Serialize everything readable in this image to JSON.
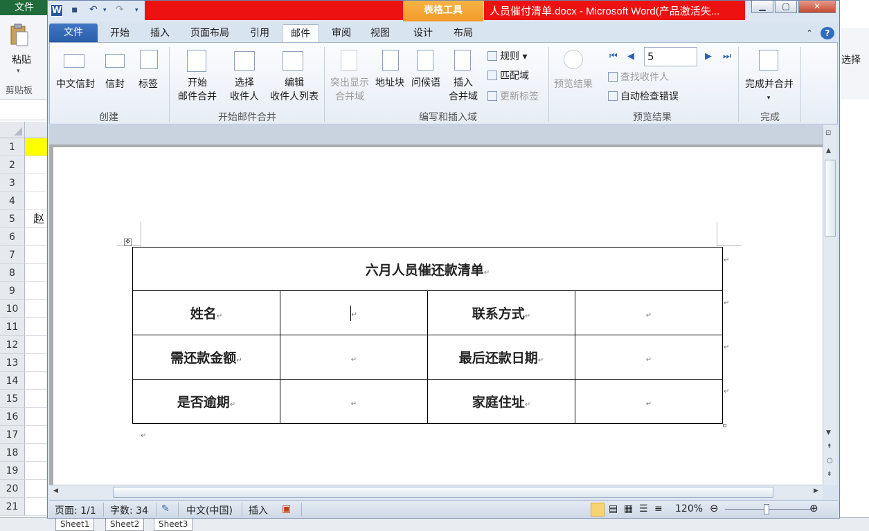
{
  "excel": {
    "file_tab": "文件",
    "paste_label": "粘贴",
    "clipboard_label": "剪贴板",
    "row_numbers": [
      "1",
      "2",
      "3",
      "4",
      "5",
      "6",
      "7",
      "8",
      "9",
      "10",
      "11",
      "12",
      "13",
      "14",
      "15",
      "16",
      "17",
      "18",
      "19",
      "20",
      "21"
    ],
    "col_a_fragments": [
      "",
      "　",
      "",
      "",
      "赵",
      "",
      "",
      "",
      "",
      "",
      "",
      "",
      "",
      "",
      "",
      "",
      "",
      "",
      "",
      "",
      ""
    ],
    "right_select_label": "选择",
    "sheet_tabs": [
      "Sheet1",
      "Sheet2",
      "Sheet3"
    ]
  },
  "word": {
    "app_icon": "W",
    "table_tools": "表格工具",
    "title": "人员催付清单.docx - Microsoft Word(产品激活失...",
    "tabs": [
      "文件",
      "开始",
      "插入",
      "页面布局",
      "引用",
      "邮件",
      "审阅",
      "视图",
      "设计",
      "布局"
    ],
    "active_tab": "邮件",
    "ribbon": {
      "create": {
        "label": "创建",
        "buttons": [
          "中文信封",
          "信封",
          "标签"
        ]
      },
      "start_merge": {
        "label": "开始邮件合并",
        "buttons": [
          [
            "开始",
            "邮件合并"
          ],
          [
            "选择",
            "收件人"
          ],
          [
            "编辑",
            "收件人列表"
          ]
        ]
      },
      "write_insert": {
        "label": "编写和插入域",
        "buttons": [
          [
            "突出显示",
            "合并域"
          ],
          [
            "地址块"
          ],
          [
            "问候语"
          ],
          [
            "插入",
            "合并域"
          ]
        ],
        "small": [
          "规则",
          "匹配域",
          "更新标签"
        ]
      },
      "preview": {
        "label": "预览结果",
        "button": "预览结果",
        "record": "5",
        "small": [
          "查找收件人",
          "自动检查错误"
        ]
      },
      "finish": {
        "label": "完成",
        "button": "完成并合并"
      }
    },
    "table": {
      "title": "六月人员催还款清单",
      "rows": [
        [
          "姓名",
          "",
          "联系方式",
          ""
        ],
        [
          "需还款金额",
          "",
          "最后还款日期",
          ""
        ],
        [
          "是否逾期",
          "",
          "家庭住址",
          ""
        ]
      ]
    },
    "status": {
      "page": "页面: 1/1",
      "words": "字数: 34",
      "language": "中文(中国)",
      "mode": "插入",
      "zoom": "120%"
    }
  },
  "colors": {
    "title_red": "#ee1111",
    "table_tools": "#f19a28",
    "file_tab": "#2a5ea8",
    "excel_green": "#1f6b3a"
  }
}
